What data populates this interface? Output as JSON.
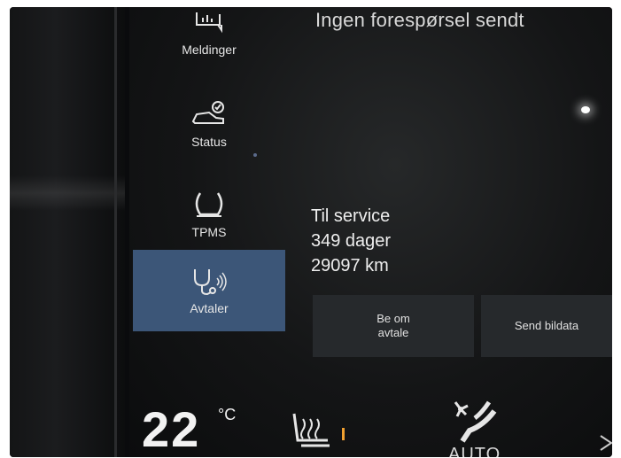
{
  "header": {
    "status_text": "Ingen forespørsel sendt"
  },
  "sidebar": {
    "items": [
      {
        "label": "Meldinger",
        "icon": "messages-icon",
        "active": false
      },
      {
        "label": "Status",
        "icon": "car-status-icon",
        "active": false
      },
      {
        "label": "TPMS",
        "icon": "tire-pressure-icon",
        "active": false
      },
      {
        "label": "Avtaler",
        "icon": "stethoscope-icon",
        "active": true
      }
    ]
  },
  "service": {
    "title": "Til service",
    "days": "349 dager",
    "distance": "29097 km"
  },
  "actions": {
    "book_line1": "Be om",
    "book_line2": "avtale",
    "send_label": "Send bildata"
  },
  "climate": {
    "temperature": "22",
    "unit": "°C",
    "auto_label": "AUTO"
  },
  "colors": {
    "active_bg": "#3c5678",
    "button_bg": "#26292c",
    "heat_indicator": "#f0a030"
  }
}
